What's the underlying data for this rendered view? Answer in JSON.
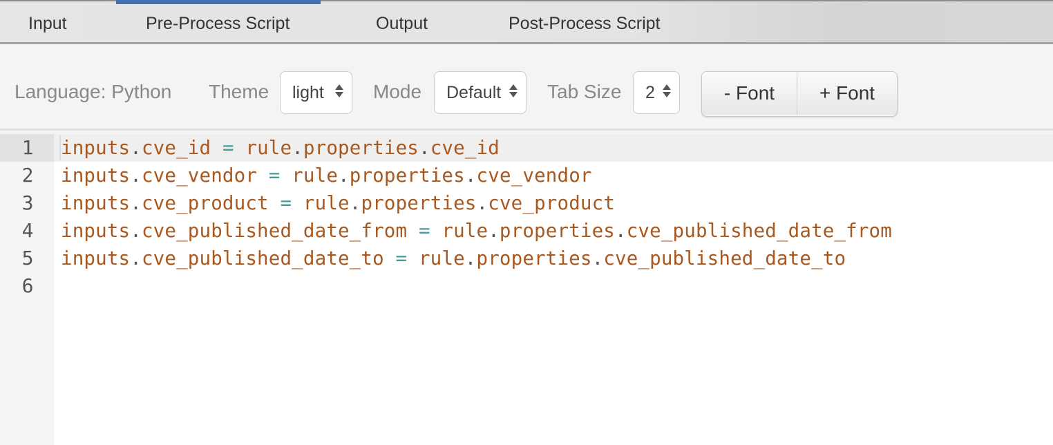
{
  "tabs": [
    {
      "label": "Input",
      "active": false
    },
    {
      "label": "Pre-Process Script",
      "active": true
    },
    {
      "label": "Output",
      "active": false
    },
    {
      "label": "Post-Process Script",
      "active": false
    }
  ],
  "toolbar": {
    "language_label": "Language: Python",
    "theme_label": "Theme",
    "theme_value": "light",
    "mode_label": "Mode",
    "mode_value": "Default",
    "tab_size_label": "Tab Size",
    "tab_size_value": "2",
    "decrease_font_label": "- Font",
    "increase_font_label": "+ Font"
  },
  "editor": {
    "active_line": 1,
    "lines": [
      {
        "number": "1",
        "tokens": [
          [
            "id",
            "inputs"
          ],
          [
            "dot",
            "."
          ],
          [
            "id",
            "cve_id"
          ],
          [
            "sp",
            " "
          ],
          [
            "op",
            "="
          ],
          [
            "sp",
            " "
          ],
          [
            "id",
            "rule"
          ],
          [
            "dot",
            "."
          ],
          [
            "id",
            "properties"
          ],
          [
            "dot",
            "."
          ],
          [
            "id",
            "cve_id"
          ]
        ]
      },
      {
        "number": "2",
        "tokens": [
          [
            "id",
            "inputs"
          ],
          [
            "dot",
            "."
          ],
          [
            "id",
            "cve_vendor"
          ],
          [
            "sp",
            " "
          ],
          [
            "op",
            "="
          ],
          [
            "sp",
            " "
          ],
          [
            "id",
            "rule"
          ],
          [
            "dot",
            "."
          ],
          [
            "id",
            "properties"
          ],
          [
            "dot",
            "."
          ],
          [
            "id",
            "cve_vendor"
          ]
        ]
      },
      {
        "number": "3",
        "tokens": [
          [
            "id",
            "inputs"
          ],
          [
            "dot",
            "."
          ],
          [
            "id",
            "cve_product"
          ],
          [
            "sp",
            " "
          ],
          [
            "op",
            "="
          ],
          [
            "sp",
            " "
          ],
          [
            "id",
            "rule"
          ],
          [
            "dot",
            "."
          ],
          [
            "id",
            "properties"
          ],
          [
            "dot",
            "."
          ],
          [
            "id",
            "cve_product"
          ]
        ]
      },
      {
        "number": "4",
        "tokens": [
          [
            "id",
            "inputs"
          ],
          [
            "dot",
            "."
          ],
          [
            "id",
            "cve_published_date_from"
          ],
          [
            "sp",
            " "
          ],
          [
            "op",
            "="
          ],
          [
            "sp",
            " "
          ],
          [
            "id",
            "rule"
          ],
          [
            "dot",
            "."
          ],
          [
            "id",
            "properties"
          ],
          [
            "dot",
            "."
          ],
          [
            "id",
            "cve_published_date_from"
          ]
        ]
      },
      {
        "number": "5",
        "tokens": [
          [
            "id",
            "inputs"
          ],
          [
            "dot",
            "."
          ],
          [
            "id",
            "cve_published_date_to"
          ],
          [
            "sp",
            " "
          ],
          [
            "op",
            "="
          ],
          [
            "sp",
            " "
          ],
          [
            "id",
            "rule"
          ],
          [
            "dot",
            "."
          ],
          [
            "id",
            "properties"
          ],
          [
            "dot",
            "."
          ],
          [
            "id",
            "cve_published_date_to"
          ]
        ]
      },
      {
        "number": "6",
        "tokens": []
      }
    ]
  },
  "colors": {
    "active_tab_indicator": "#4472b0",
    "identifier": "#a9581f",
    "operator": "#4a9a9a",
    "punctuation": "#555555"
  }
}
